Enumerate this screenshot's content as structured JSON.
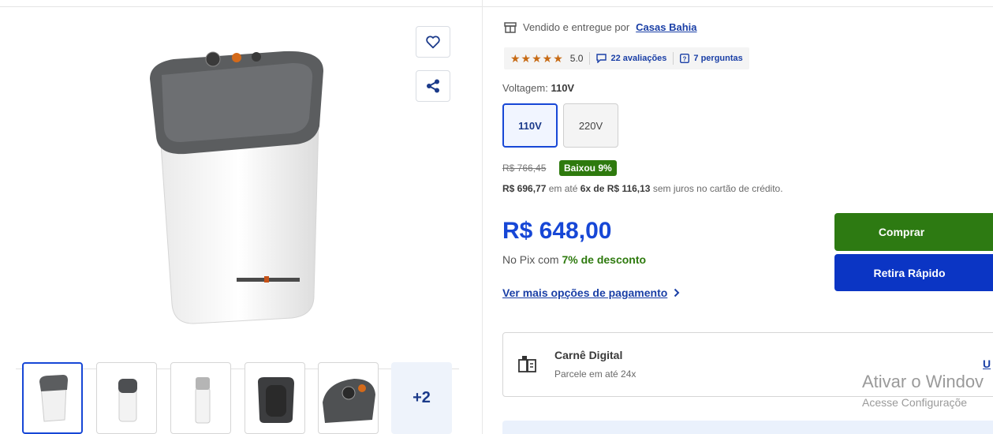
{
  "seller": {
    "prefix": "Vendido e entregue por",
    "name": "Casas Bahia"
  },
  "rating": {
    "stars": "★★★★★",
    "score": "5.0",
    "reviews": "22 avaliações",
    "questions": "7 perguntas"
  },
  "voltage": {
    "label": "Voltagem:",
    "selected": "110V",
    "options": [
      "110V",
      "220V"
    ]
  },
  "pricing": {
    "old_price": "R$ 766,45",
    "badge": "Baixou 9%",
    "installment_price": "R$ 696,77",
    "installment_mid": " em até ",
    "installment_plan": "6x de R$ 116,13",
    "installment_tail": " sem juros no cartão de crédito.",
    "price": "R$ 648,00",
    "pix_prefix": "No Pix com ",
    "pix_discount": "7% de desconto",
    "more_options": "Ver mais opções de pagamento"
  },
  "actions": {
    "buy": "Comprar",
    "pickup": "Retira Rápido"
  },
  "carne": {
    "title": "Carnê Digital",
    "subtitle": "Parcele em até 24x",
    "link": "U"
  },
  "gallery": {
    "more_count": "+2"
  },
  "windows_overlay": {
    "line1": "Ativar o Windov",
    "line2": "Acesse Configuraçõe"
  },
  "colors": {
    "primary_blue": "#1747d6",
    "buy_green": "#2d7a12",
    "pickup_blue": "#0b35c4",
    "rating_star": "#c76a14"
  }
}
